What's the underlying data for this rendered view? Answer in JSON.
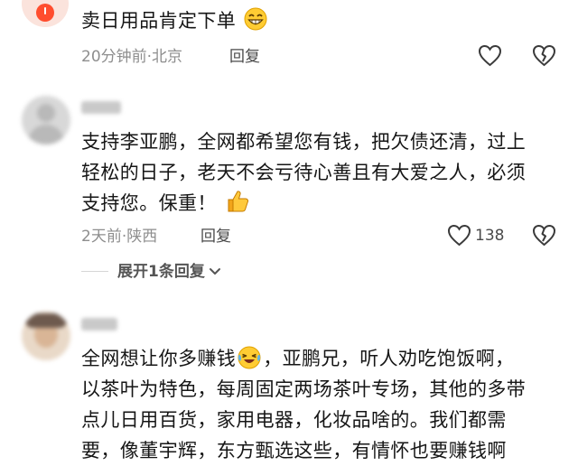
{
  "comments": [
    {
      "text": "卖日用品肯定下单",
      "emoji": "grinning-face-icon",
      "time": "20分钟前",
      "location": "北京",
      "reply_label": "回复"
    },
    {
      "text_lines": [
        "支持李亚鹏，全网都希望您有钱，把欠债还清，过上",
        "轻松的日子，老天不会亏待心善且有大爱之人，必须",
        "支持您。保重！"
      ],
      "emoji": "thumbs-up-icon",
      "time": "2天前",
      "location": "陕西",
      "reply_label": "回复",
      "likes": "138",
      "expand_label": "展开1条回复"
    },
    {
      "text_lines": [
        "全网想让你多赚钱",
        "，亚鹏兄，听人劝吃饱饭啊，",
        "以茶叶为特色，每周固定两场茶叶专场，其他的多带",
        "点儿日用百货，家用电器，化妆品啥的。我们都需",
        "要，像董宇辉，东方甄选这些，有情怀也要赚钱啊"
      ],
      "emoji": "laughing-tears-icon"
    }
  ],
  "separator": "·",
  "colors": {
    "text": "#161616",
    "meta": "#8e8e8e",
    "icon": "#3a3a3a"
  }
}
